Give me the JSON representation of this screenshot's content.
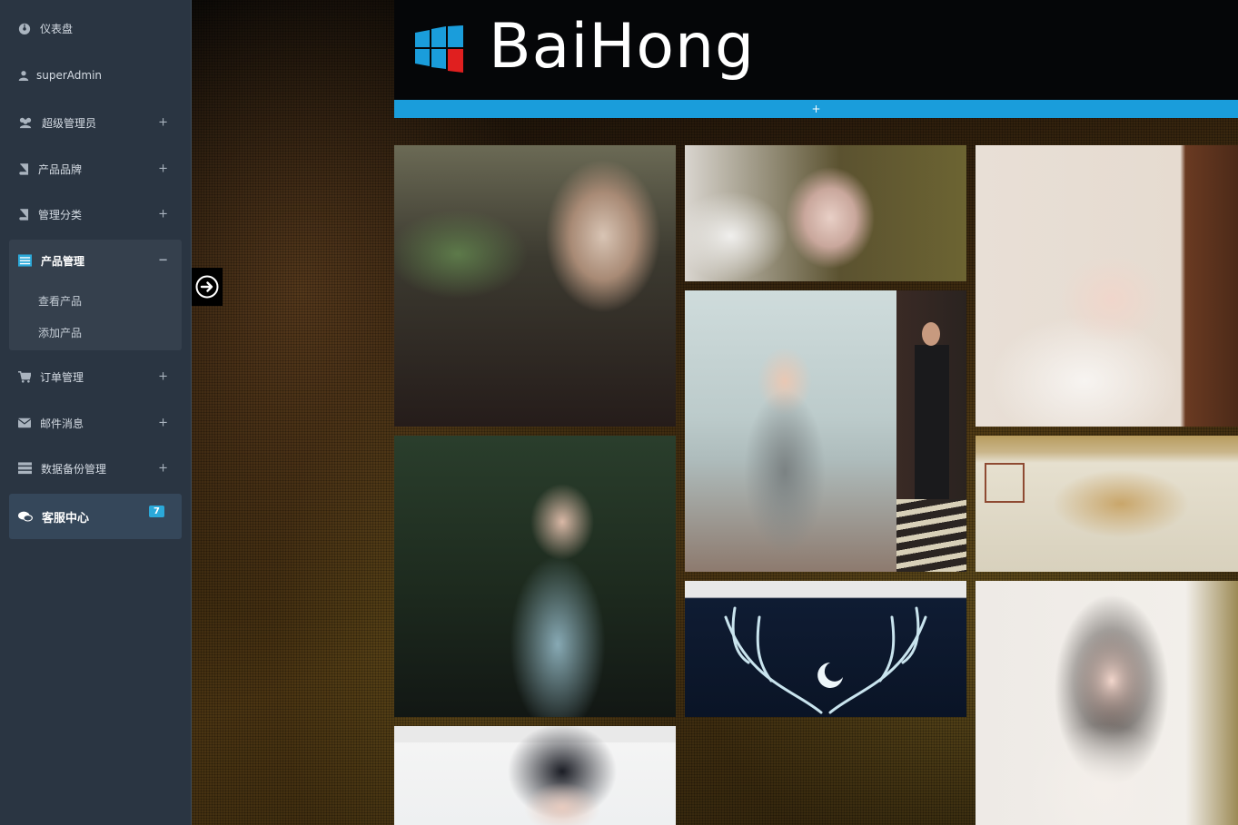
{
  "sidebar": {
    "items": [
      {
        "label": "仪表盘",
        "icon": "dashboard-icon"
      },
      {
        "label": "superAdmin",
        "icon": "user-icon"
      },
      {
        "label": "超级管理员",
        "icon": "users-icon",
        "toggle": "+"
      },
      {
        "label": "产品品牌",
        "icon": "book-icon",
        "toggle": "+"
      },
      {
        "label": "管理分类",
        "icon": "book-icon",
        "toggle": "+"
      },
      {
        "label": "产品管理",
        "icon": "list-icon",
        "toggle": "−",
        "children": [
          {
            "label": "查看产品"
          },
          {
            "label": "添加产品"
          }
        ]
      },
      {
        "label": "订单管理",
        "icon": "cart-icon",
        "toggle": "+"
      },
      {
        "label": "邮件消息",
        "icon": "envelope-icon",
        "toggle": "+"
      },
      {
        "label": "数据备份管理",
        "icon": "database-icon",
        "toggle": "+"
      },
      {
        "label": "客服中心",
        "icon": "chat-icon",
        "badge": "7"
      }
    ]
  },
  "header": {
    "logo_text": "BaiHong",
    "bar_label": "+"
  },
  "colors": {
    "sidebar_bg": "#2a3542",
    "accent_blue": "#1a9ddb",
    "badge_blue": "#2ba9d9"
  },
  "gallery": {
    "tiles": [
      {
        "name": "photo-woman-tea-balcony"
      },
      {
        "name": "photo-girl-pillow"
      },
      {
        "name": "photo-girl-bed-white"
      },
      {
        "name": "photo-girl-seaside"
      },
      {
        "name": "photo-man-street"
      },
      {
        "name": "photo-girl-antlers-forest"
      },
      {
        "name": "photo-chinese-dragon-painting"
      },
      {
        "name": "photo-antlers-moon-night"
      },
      {
        "name": "photo-girl-white-sweater"
      },
      {
        "name": "photo-girl-bangs"
      }
    ]
  }
}
